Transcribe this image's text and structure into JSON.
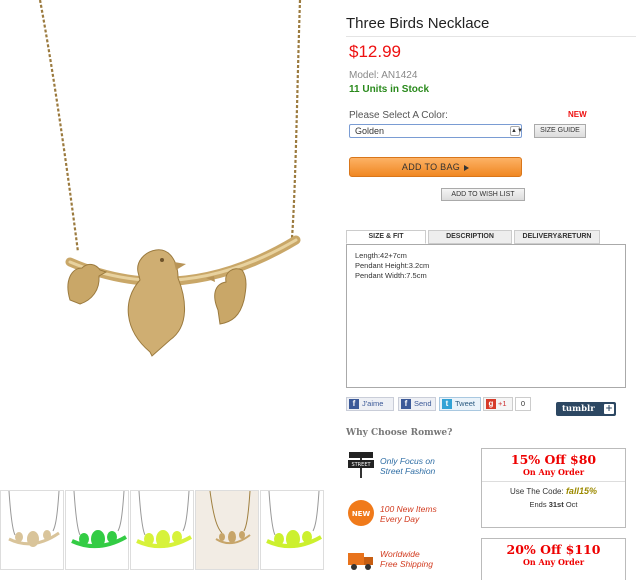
{
  "product": {
    "title": "Three Birds Necklace",
    "price": "$12.99",
    "model": "Model: AN1424",
    "stock": "11 Units in Stock"
  },
  "color_picker": {
    "label": "Please Select A Color:",
    "new_badge": "NEW",
    "selected": "Golden",
    "size_guide": "SIZE GUIDE"
  },
  "actions": {
    "add_to_bag": "ADD TO BAG",
    "add_to_wish_list": "ADD TO WISH LIST"
  },
  "tabs": [
    {
      "label": "SIZE & FIT",
      "active": true
    },
    {
      "label": "DESCRIPTION",
      "active": false
    },
    {
      "label": "DELIVERY&RETURN",
      "active": false
    }
  ],
  "size_fit": {
    "length": "Length:42+7cm",
    "pendant_height": "Pendant Height:3.2cm",
    "pendant_width": "Pendant Width:7.5cm"
  },
  "social": {
    "like": "J'aime",
    "send": "Send",
    "tweet": "Tweet",
    "plus_one": "+1",
    "count": "0",
    "tumblr": "tumblr"
  },
  "why": {
    "heading": "Why Choose Romwe?",
    "perks": [
      {
        "icon": "fashion-street-icon",
        "line1": "Only Focus on",
        "line2": "Street Fashion"
      },
      {
        "icon": "new-badge-icon",
        "line1": "100 New Items",
        "line2": "Every Day"
      },
      {
        "icon": "delivery-truck-icon",
        "line1": "Worldwide",
        "line2": "Free Shipping"
      }
    ]
  },
  "coupons": [
    {
      "headline": "15% Off  $80",
      "sub": "On Any Order",
      "code_label": "Use The Code:",
      "code": "fall15%",
      "ends_prefix": "Ends",
      "ends_date": "31st",
      "ends_month": "Oct"
    },
    {
      "headline": "20% Off  $110",
      "sub": "On Any Order"
    }
  ],
  "colors": {
    "price": "#ee1111",
    "stock": "#2a8a1c",
    "add_to_bag": "#f08722",
    "gold": "#c7a56a",
    "thumb_variants": [
      "#d9c49a",
      "#33cc44",
      "#d7f23a",
      "#c7a56a",
      "#ccf02e"
    ]
  }
}
